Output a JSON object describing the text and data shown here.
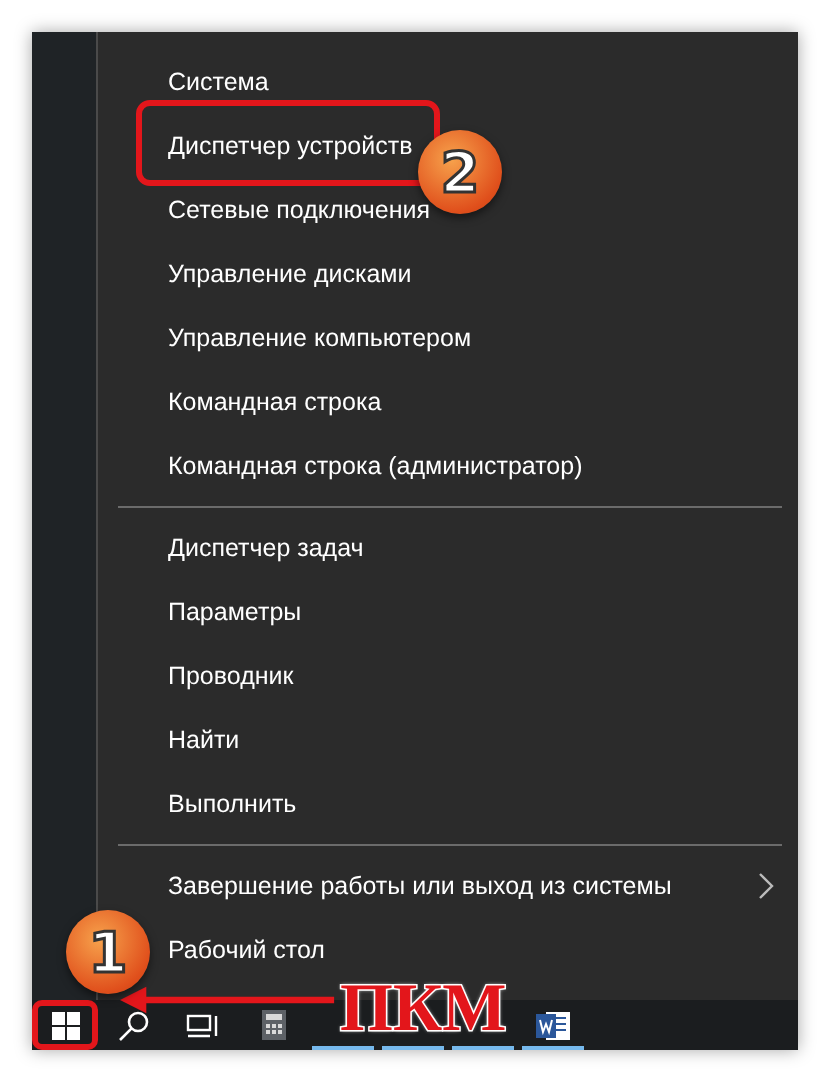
{
  "menu": {
    "groups": [
      [
        {
          "label": "Система",
          "marked": false,
          "submenu": false
        },
        {
          "label": "Диспетчер устройств",
          "marked": true,
          "submenu": false
        },
        {
          "label": "Сетевые подключения",
          "marked": false,
          "submenu": false
        },
        {
          "label": "Управление дисками",
          "marked": false,
          "submenu": false
        },
        {
          "label": "Управление компьютером",
          "marked": false,
          "submenu": false
        },
        {
          "label": "Командная строка",
          "marked": false,
          "submenu": false
        },
        {
          "label": "Командная строка (администратор)",
          "marked": false,
          "submenu": false
        }
      ],
      [
        {
          "label": "Диспетчер задач",
          "marked": false,
          "submenu": false
        },
        {
          "label": "Параметры",
          "marked": false,
          "submenu": false
        },
        {
          "label": "Проводник",
          "marked": false,
          "submenu": false
        },
        {
          "label": "Найти",
          "marked": false,
          "submenu": false
        },
        {
          "label": "Выполнить",
          "marked": false,
          "submenu": false
        }
      ],
      [
        {
          "label": "Завершение работы или выход из системы",
          "marked": false,
          "submenu": true
        },
        {
          "label": "Рабочий стол",
          "marked": false,
          "submenu": false
        }
      ]
    ]
  },
  "taskbar": [
    {
      "kind": "start",
      "marked": true
    },
    {
      "kind": "search",
      "marked": false
    },
    {
      "kind": "taskview",
      "marked": false
    },
    {
      "kind": "calculator",
      "marked": false
    },
    {
      "kind": "app",
      "marked": false
    },
    {
      "kind": "app",
      "marked": false
    },
    {
      "kind": "app",
      "marked": false
    },
    {
      "kind": "word",
      "marked": false
    }
  ],
  "annotations": {
    "menu_callout": "2",
    "taskbar_callout": "1",
    "action_label": "ПКМ"
  }
}
